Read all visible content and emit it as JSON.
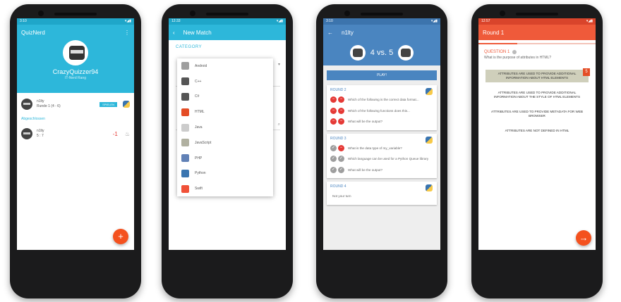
{
  "colors": {
    "quiz_blue": "#2db7da",
    "match_blue": "#4a85c0",
    "round_red": "#ef5a3a",
    "fab_orange": "#f4511e"
  },
  "home": {
    "time": "3:10",
    "title": "QuizNerd",
    "menu_icon": "more-vert-icon",
    "username": "CrazyQuizzer94",
    "subtitle": "IT-Nerd Rang",
    "matches": [
      {
        "name": "n1lty",
        "detail": "Runde 1 (4 - 6)",
        "badge": "SPIELEN"
      }
    ],
    "section_label": "Abgeschlossen",
    "finished": [
      {
        "name": "n1lty",
        "detail": "5 : 7",
        "score": "-1"
      }
    ],
    "fab_label": "+"
  },
  "new_match": {
    "time": "12:33",
    "title": "New Match",
    "back_icon": "back-arrow-icon",
    "category_label": "CATEGORY",
    "categories": [
      {
        "label": "Android",
        "icon": "android-icon",
        "color": "#9e9e9e"
      },
      {
        "label": "C++",
        "icon": "cpp-icon",
        "color": "#555555"
      },
      {
        "label": "C#",
        "icon": "csharp-icon",
        "color": "#555555"
      },
      {
        "label": "HTML",
        "icon": "html5-icon",
        "color": "#e44d26"
      },
      {
        "label": "Java",
        "icon": "java-icon",
        "color": "#cccccc"
      },
      {
        "label": "JavaScript",
        "icon": "javascript-icon",
        "color": "#b0b0a0"
      },
      {
        "label": "PHP",
        "icon": "php-icon",
        "color": "#6181b6"
      },
      {
        "label": "Python",
        "icon": "python-icon",
        "color": "#3a75b0"
      },
      {
        "label": "Swift",
        "icon": "swift-icon",
        "color": "#f05138"
      }
    ]
  },
  "match": {
    "time": "3:10",
    "title": "n1lty",
    "score": "4 vs. 5",
    "play_label": "PLAY!",
    "rounds": [
      {
        "title": "ROUND 2",
        "questions": [
          {
            "left": "no",
            "right": "no",
            "text": "Which of the following is the correct data format..."
          },
          {
            "left": "no",
            "right": "no",
            "text": "Which of the following functions does this..."
          },
          {
            "left": "no",
            "right": "no",
            "text": "What will be the output?"
          }
        ]
      },
      {
        "title": "ROUND 3",
        "questions": [
          {
            "left": "ok",
            "right": "no",
            "text": "What is the data type of my_variable?"
          },
          {
            "left": "ok",
            "right": "ok",
            "text": "Which language can be used for a Python Queue library"
          },
          {
            "left": "ok",
            "right": "ok",
            "text": "What will be the output?"
          }
        ]
      },
      {
        "title": "ROUND 4",
        "questions": [
          {
            "left": "",
            "right": "",
            "text": "Not your turn"
          }
        ]
      }
    ]
  },
  "round": {
    "time": "12:57",
    "title": "Round 1",
    "progress": 0.33,
    "question_label": "QUESTION 1",
    "question": "What is the purpose of attributes in HTML?",
    "answers": [
      {
        "text": "ATTRIBUTES ARE USED TO PROVIDE ADDITIONAL INFORMATION ABOUT HTML ELEMENTS",
        "selected": true
      },
      {
        "text": "ATTRIBUTES ARE USED TO PROVIDE ADDITIONAL INFORMATION ABOUT THE STYLE OF HTML ELEMENTS",
        "selected": false
      },
      {
        "text": "ATTRIBUTES ARE USED TO PROVIDE METADATA FOR WEB BROWSER",
        "selected": false
      },
      {
        "text": "ATTRIBUTES ARE NOT DEFINED IN HTML",
        "selected": false
      }
    ],
    "fab_label": "→"
  }
}
